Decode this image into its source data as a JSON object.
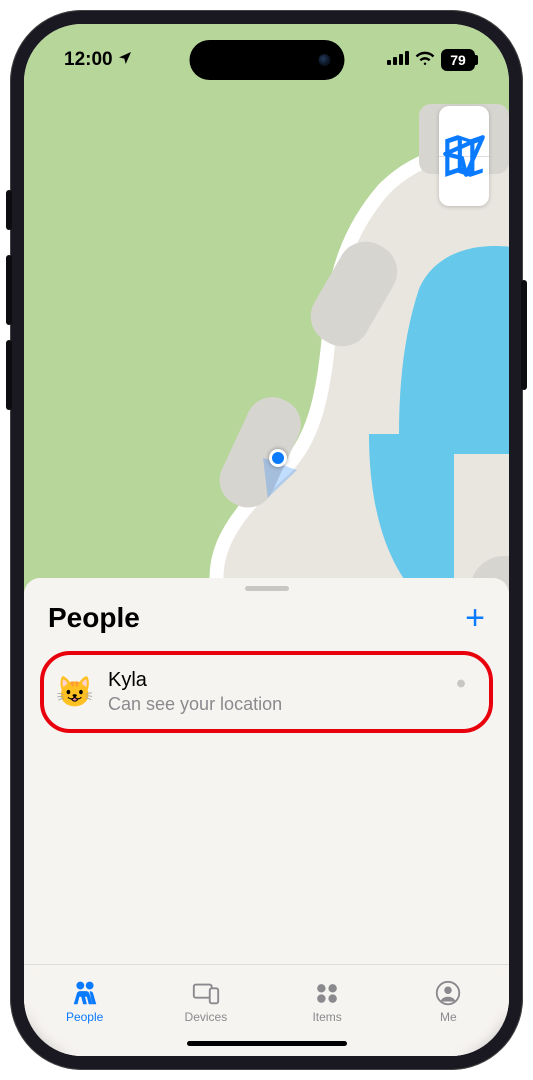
{
  "status": {
    "time": "12:00",
    "battery": "79"
  },
  "sheet": {
    "title": "People"
  },
  "person": {
    "avatar_emoji": "😺",
    "name": "Kyla",
    "subtitle": "Can see your location"
  },
  "tabs": {
    "people": "People",
    "devices": "Devices",
    "items": "Items",
    "me": "Me"
  }
}
